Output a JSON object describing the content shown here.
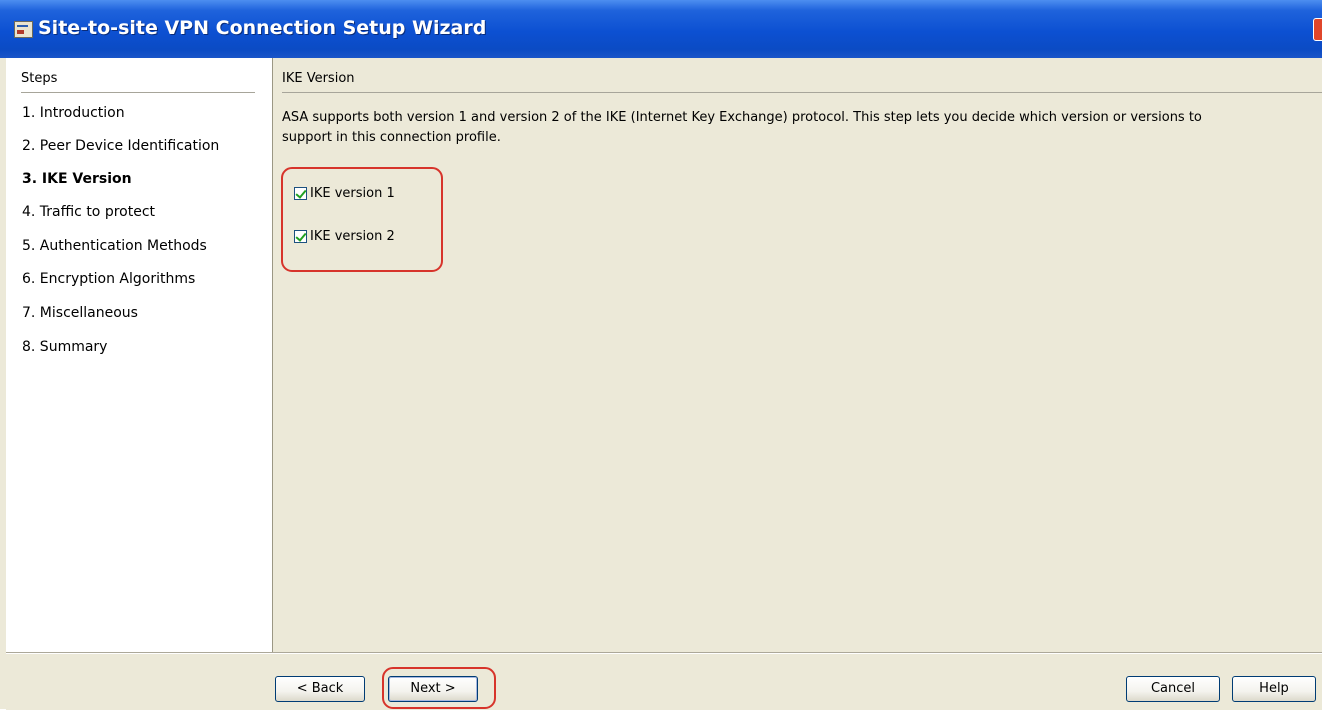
{
  "window": {
    "title": "Site-to-site VPN Connection Setup Wizard",
    "icon": "wizard-icon"
  },
  "steps_panel": {
    "header": "Steps",
    "items": [
      {
        "label": "1.  Introduction",
        "active": false
      },
      {
        "label": "2.  Peer Device Identification",
        "active": false
      },
      {
        "label": "3.  IKE Version",
        "active": true
      },
      {
        "label": "4.  Traffic to protect",
        "active": false
      },
      {
        "label": "5.  Authentication Methods",
        "active": false
      },
      {
        "label": "6.  Encryption Algorithms",
        "active": false
      },
      {
        "label": "7.  Miscellaneous",
        "active": false
      },
      {
        "label": "8.  Summary",
        "active": false
      }
    ]
  },
  "content": {
    "header": "IKE Version",
    "description_line1": "ASA supports both version 1 and version 2 of the IKE (Internet Key Exchange) protocol. This step lets you decide which version or versions to",
    "description_line2": "support in this connection profile.",
    "options": [
      {
        "label": "IKE version 1",
        "checked": true
      },
      {
        "label": "IKE version 2",
        "checked": true
      }
    ]
  },
  "footer": {
    "back_label": "< Back",
    "next_label": "Next >",
    "cancel_label": "Cancel",
    "help_label": "Help"
  },
  "colors": {
    "titlebar": "#0c50d2",
    "dialog_background": "#ece9d8",
    "highlight_annotation": "#d7342b",
    "checkmark": "#21a121"
  }
}
